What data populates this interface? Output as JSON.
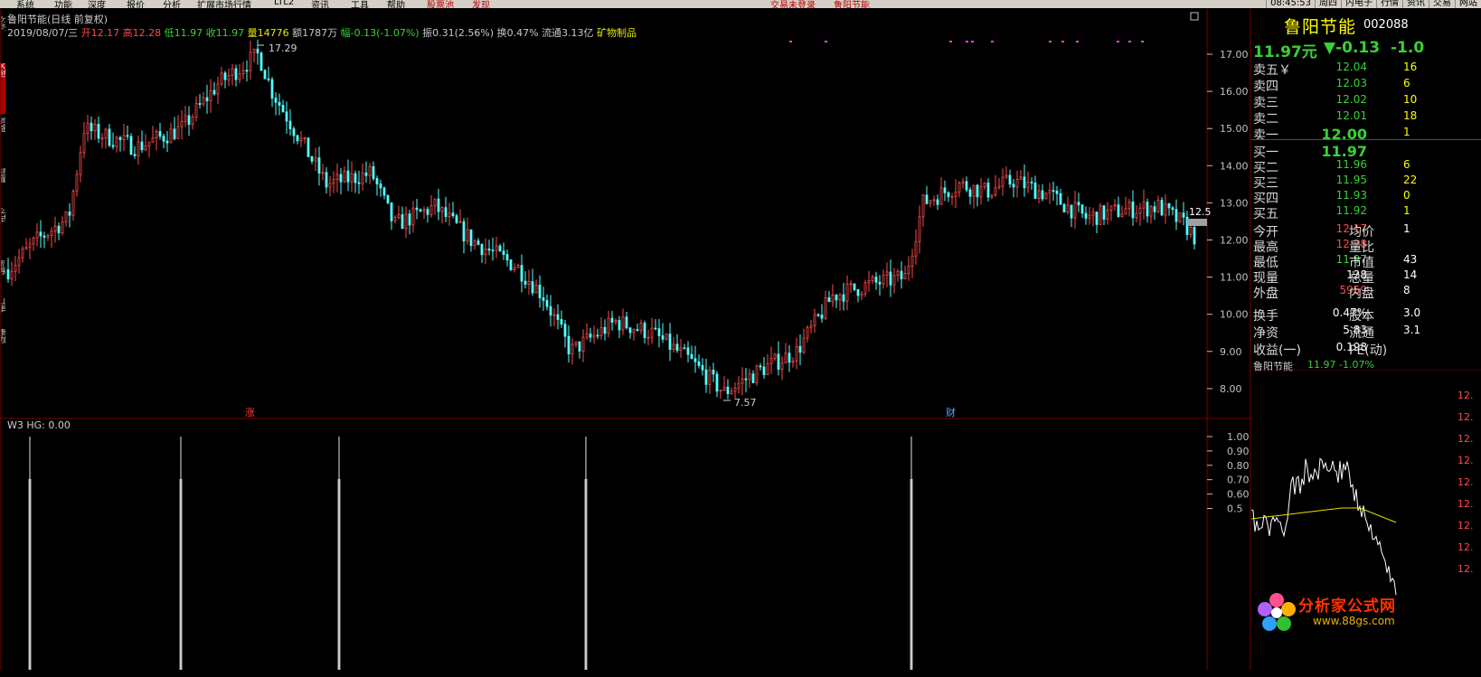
{
  "menu": {
    "items": [
      "系统",
      "功能",
      "深度",
      "报价",
      "分析",
      "扩展市场行情",
      "LTL2",
      "资讯",
      "工具",
      "帮助",
      "股票池",
      "发现"
    ],
    "warn": [
      "交易未登录",
      "鲁阳节能"
    ],
    "time": "08:45:53",
    "right_tabs": [
      "周四",
      "内电子",
      "行情",
      "资讯",
      "交易",
      "网站"
    ]
  },
  "left_tabs": [
    "分时",
    "K线",
    "资金",
    "测量",
    "公式",
    "扩展",
    "工具",
    "叠加"
  ],
  "title": "鲁阳节能(日线 前复权)",
  "ohlc": {
    "date": "2019/08/07/三",
    "open_label": "开",
    "open": "12.17",
    "high_label": "高",
    "high": "12.28",
    "low_label": "低",
    "low": "11.97",
    "close_label": "收",
    "close": "11.97",
    "vol_label": "量",
    "vol": "14776",
    "amt_label": "额",
    "amt": "1787万",
    "chg_label": "幅",
    "chg": "-0.13(-1.07%)",
    "amp_label": "振",
    "amp": "0.31(2.56%)",
    "turn_label": "换",
    "turn": "0.47%",
    "float_label": "流通",
    "float": "3.13亿",
    "industry": "矿物制品"
  },
  "price_axis": [
    "17.00",
    "16.00",
    "15.00",
    "14.00",
    "13.00",
    "12.00",
    "11.00",
    "10.00",
    "9.00",
    "8.00"
  ],
  "annotations": {
    "high": "17.29",
    "low": "7.57",
    "cur": "12.5"
  },
  "markers": [
    "涨",
    "财"
  ],
  "indicator": {
    "title": "W3 HG: 0.00",
    "axis": [
      "1.00",
      "0.90",
      "0.80",
      "0.70",
      "0.60",
      "0.5"
    ],
    "spikes": [
      33,
      200,
      375,
      648,
      1008
    ]
  },
  "quote": {
    "name": "鲁阳节能",
    "code": "002088",
    "price": "11.97元",
    "chg": "▼-0.13",
    "pct": "-1.0",
    "sell": [
      {
        "label": "卖五",
        "tag": "￥",
        "price": "12.04",
        "vol": "16"
      },
      {
        "label": "卖四",
        "tag": "",
        "price": "12.03",
        "vol": "6"
      },
      {
        "label": "卖三",
        "tag": "",
        "price": "12.02",
        "vol": "10"
      },
      {
        "label": "卖二",
        "tag": "",
        "price": "12.01",
        "vol": "18"
      },
      {
        "label": "卖一",
        "tag": "",
        "price": "12.00",
        "vol": "1"
      }
    ],
    "buy": [
      {
        "label": "买一",
        "price": "11.97",
        "vol": ""
      },
      {
        "label": "买二",
        "price": "11.96",
        "vol": "6"
      },
      {
        "label": "买三",
        "price": "11.95",
        "vol": "22"
      },
      {
        "label": "买四",
        "price": "11.93",
        "vol": "0"
      },
      {
        "label": "买五",
        "price": "11.92",
        "vol": "1"
      }
    ],
    "stats": [
      {
        "l1": "今开",
        "v1": "12.17",
        "c1": "#ff4a4a",
        "l2": "均价",
        "v2": "1"
      },
      {
        "l1": "最高",
        "v1": "12.28",
        "c1": "#ff4a4a",
        "l2": "量比",
        "v2": ""
      },
      {
        "l1": "最低",
        "v1": "11.97",
        "c1": "#37d237",
        "l2": "市值",
        "v2": "43"
      },
      {
        "l1": "现量",
        "v1": "128",
        "c1": "#ffffff",
        "l2": "总量",
        "v2": "14"
      },
      {
        "l1": "外盘",
        "v1": "5959",
        "c1": "#ff4a4a",
        "l2": "内盘",
        "v2": "8"
      }
    ],
    "stats2": [
      {
        "l1": "换手",
        "v1": "0.47%",
        "l2": "股本",
        "v2": "3.0"
      },
      {
        "l1": "净资",
        "v1": "5.83",
        "l2": "流通",
        "v2": "3.1"
      },
      {
        "l1": "收益(一)",
        "v1": "0.198",
        "l2": "PE(动)",
        "v2": ""
      }
    ],
    "mini_name": "鲁阳节能",
    "mini_price": "11.97  -1.07%",
    "mini_axis": [
      "12.",
      "12.",
      "12.",
      "12.",
      "12.",
      "12.",
      "12.",
      "12.",
      "12."
    ]
  },
  "logo": {
    "text": "分析家公式网",
    "url": "www.88gs.com"
  },
  "colors": {
    "up": "#ff4a4a",
    "down": "#37d237",
    "bg": "#000000",
    "grid": "#7a0000",
    "avg": "#e6e600"
  }
}
